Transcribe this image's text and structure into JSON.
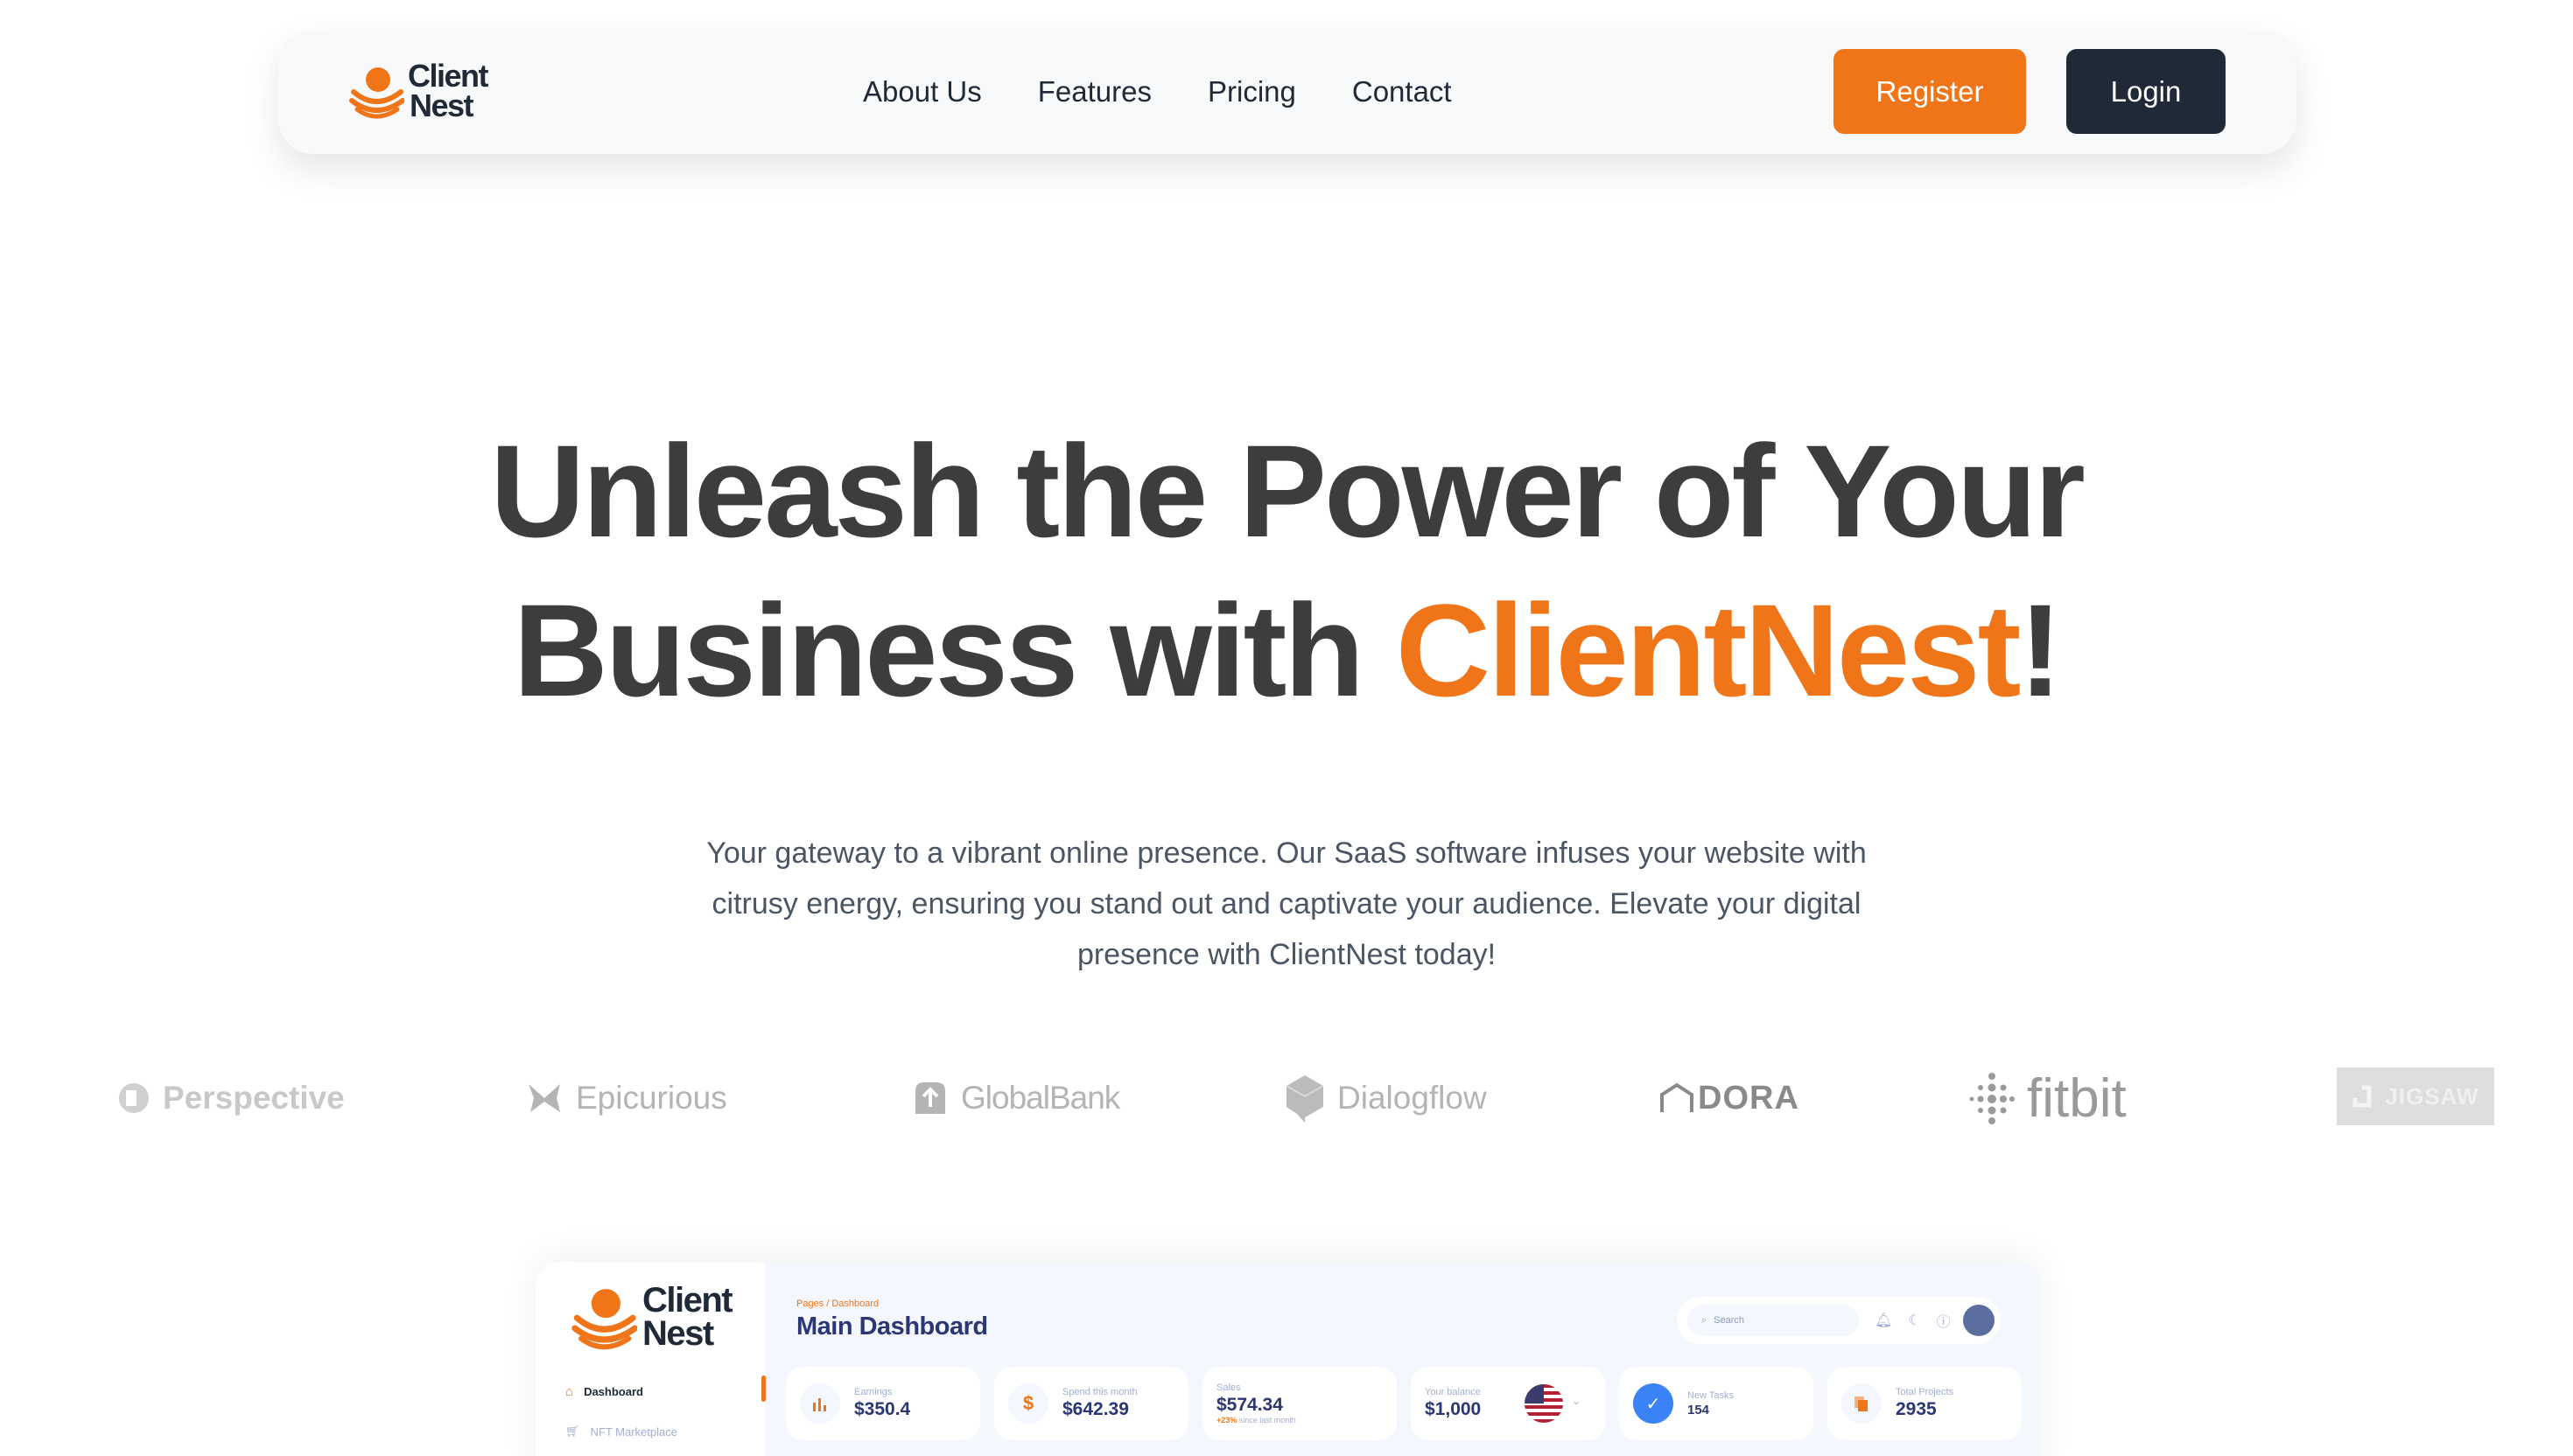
{
  "nav": {
    "logo_line1": "Client",
    "logo_line2": "Nest",
    "links": [
      "About Us",
      "Features",
      "Pricing",
      "Contact"
    ],
    "register_label": "Register",
    "login_label": "Login"
  },
  "hero": {
    "title_line1": "Unleash the Power of Your",
    "title_line2_pre": "Business with ",
    "title_brand": "ClientNest",
    "title_line2_post": "!",
    "subtitle": "Your gateway to a vibrant online presence. Our SaaS software infuses your website with citrusy energy, ensuring you stand out and captivate your audience. Elevate your digital presence with ClientNest today!"
  },
  "brands": [
    "Perspective",
    "Epicurious",
    "GlobalBank",
    "Dialogflow",
    "DORA",
    "fitbit",
    "JIGSAW"
  ],
  "dashboard": {
    "logo_line1": "Client",
    "logo_line2": "Nest",
    "breadcrumb": "Pages / Dashboard",
    "title": "Main Dashboard",
    "search_placeholder": "Search",
    "nav_active": "Dashboard",
    "nav_next": "NFT Marketplace",
    "cards": [
      {
        "label": "Earnings",
        "value": "$350.4",
        "icon": "bar-chart-icon"
      },
      {
        "label": "Spend this month",
        "value": "$642.39",
        "icon": "dollar-icon"
      },
      {
        "label": "Sales",
        "value": "$574.34",
        "note_highlight": "+23%",
        "note": " since last month"
      },
      {
        "label": "Your balance",
        "value": "$1,000",
        "icon": "us-flag-icon"
      },
      {
        "label": "New Tasks",
        "value": "154",
        "icon": "check-icon"
      },
      {
        "label": "Total Projects",
        "value": "2935",
        "icon": "files-icon"
      }
    ]
  },
  "colors": {
    "brand_orange": "#f07418",
    "dark": "#1f2937",
    "hero_text": "#3d3d3d",
    "logo_gray": "#b4b4b4"
  }
}
